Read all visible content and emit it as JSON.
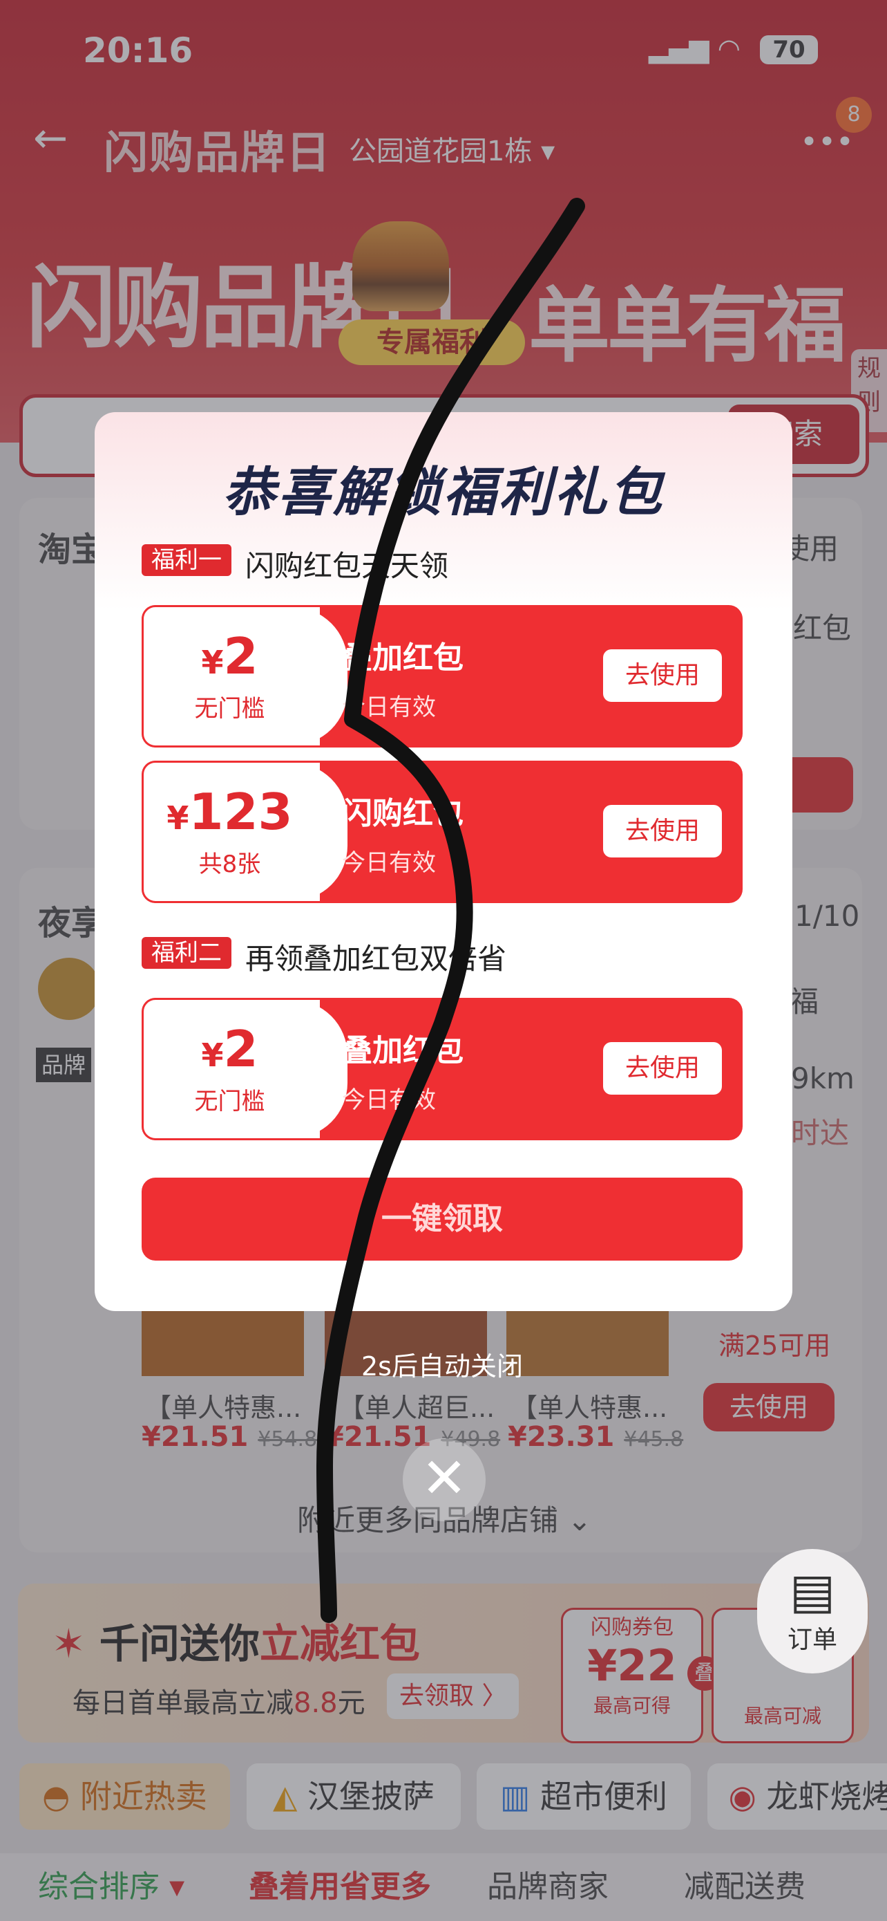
{
  "status_bar": {
    "time": "20:16",
    "battery": "70"
  },
  "header": {
    "title": "闪购品牌日",
    "address": "公园道花园1栋",
    "notification_count": "8"
  },
  "hero": {
    "banner_left": "闪购品牌日",
    "banner_right": "单单有福利",
    "exclusive_tag": "专属福利",
    "rules": "规则"
  },
  "background": {
    "search_button": "搜索",
    "taobao_section": "淘宝",
    "use_label": "使用",
    "red_pack": "红包",
    "nightsnack_section": "夜享",
    "page_indicator": "1/10",
    "blessing": "福",
    "distance": "9km",
    "time_reach": "时达",
    "brand_tag": "品牌",
    "coupon_threshold": "满25可用",
    "use_button": "去使用",
    "products": [
      {
        "name": "【单人特惠...",
        "price": "¥21.51",
        "orig": "¥54.8"
      },
      {
        "name": "【单人超巨...",
        "price": "¥21.51",
        "orig": "¥49.8"
      },
      {
        "name": "【单人特惠...",
        "price": "¥23.31",
        "orig": "¥45.8"
      }
    ],
    "more_stores": "附近更多同品牌店铺",
    "promo_title_1": "千问送你",
    "promo_title_2": "立减红包",
    "promo_sub_prefix": "每日首单最高立减",
    "promo_sub_amount": "8.8",
    "promo_sub_unit": "元",
    "promo_claim": "去领取 〉",
    "voucher1_label": "闪购券包",
    "voucher1_amount": "¥22",
    "voucher1_sub": "最高可得",
    "voucher_plus": "叠",
    "voucher2_sub": "最高可减",
    "order": "订单",
    "categories": [
      "附近热卖",
      "汉堡披萨",
      "超市便利",
      "龙虾烧烤"
    ],
    "sort": [
      "综合排序",
      "叠着用省更多",
      "品牌商家",
      "减配送费"
    ]
  },
  "modal": {
    "title": "恭喜解锁福利礼包",
    "benefit1_tag": "福利一",
    "benefit1_desc": "闪购红包天天领",
    "benefit2_tag": "福利二",
    "benefit2_desc": "再领叠加红包双倍省",
    "coupons": [
      {
        "amount": "2",
        "sub": "无门槛",
        "title": "叠加红包",
        "validity": "今日有效",
        "button": "去使用"
      },
      {
        "amount": "123",
        "sub": "共8张",
        "title": "闪购红包",
        "validity": "今日有效",
        "button": "去使用"
      },
      {
        "amount": "2",
        "sub": "无门槛",
        "title": "叠加红包",
        "validity": "今日有效",
        "button": "去使用"
      }
    ],
    "currency": "¥",
    "claim_button": "一键领取",
    "auto_close": "2s后自动关闭",
    "close": "✕"
  },
  "colors": {
    "brand_red": "#e02a2f",
    "title_navy": "#1e2547"
  }
}
